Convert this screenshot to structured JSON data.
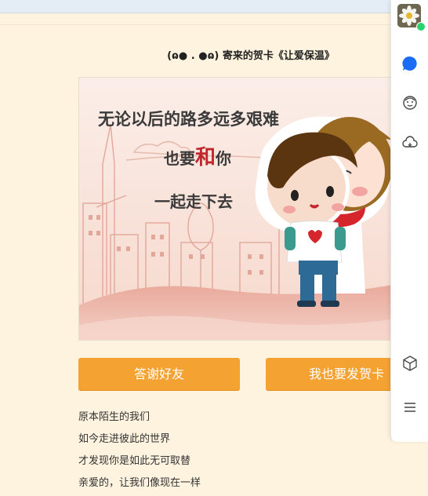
{
  "page": {
    "title": "(ɷ● . ●ɷ) 寄来的贺卡《让爱保温》"
  },
  "card": {
    "line1": "无论以后的路多远多艰难",
    "line2_prefix": "也要",
    "line2_emph": "和",
    "line2_suffix": "你",
    "line3": "一起走下去"
  },
  "buttons": {
    "thanks": "答谢好友",
    "send": "我也要发贺卡"
  },
  "poem": [
    "原本陌生的我们",
    "如今走进彼此的世界",
    "才发现你是如此无可取替",
    "亲爱的，让我们像现在一样"
  ],
  "sidebar": {
    "icons": [
      "avatar",
      "chat-bubble-icon",
      "face-icon",
      "cloud-icon",
      "cube-icon",
      "menu-icon"
    ]
  },
  "colors": {
    "background": "#fdf3df",
    "button": "#f4a232",
    "online": "#2bd36b",
    "chat_blue": "#1a6cf5"
  }
}
